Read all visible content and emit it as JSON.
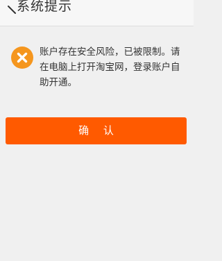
{
  "header": {
    "title": "系统提示",
    "back_icon": "back-arrow-icon"
  },
  "message": {
    "icon": "error-x-icon",
    "icon_color": "#f5961e",
    "text": "账户存在安全风险，已被限制。请在电脑上打开淘宝网，登录账户自助开通。"
  },
  "actions": {
    "confirm_label": "确 认",
    "confirm_color": "#ff5a00"
  }
}
